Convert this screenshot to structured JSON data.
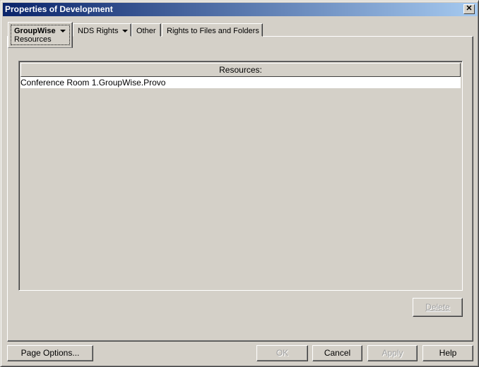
{
  "window": {
    "title": "Properties of Development",
    "close_label": "✕"
  },
  "tabs": [
    {
      "label": "GroupWise",
      "sublabel": "Resources"
    },
    {
      "label": "NDS Rights"
    },
    {
      "label": "Other"
    },
    {
      "label": "Rights to Files and Folders"
    }
  ],
  "table": {
    "header": "Resources:",
    "rows": [
      "Conference Room 1.GroupWise.Provo"
    ]
  },
  "buttons": {
    "delete": "Delete",
    "page_options": "Page Options...",
    "ok": "OK",
    "cancel": "Cancel",
    "apply": "Apply",
    "help": "Help"
  }
}
